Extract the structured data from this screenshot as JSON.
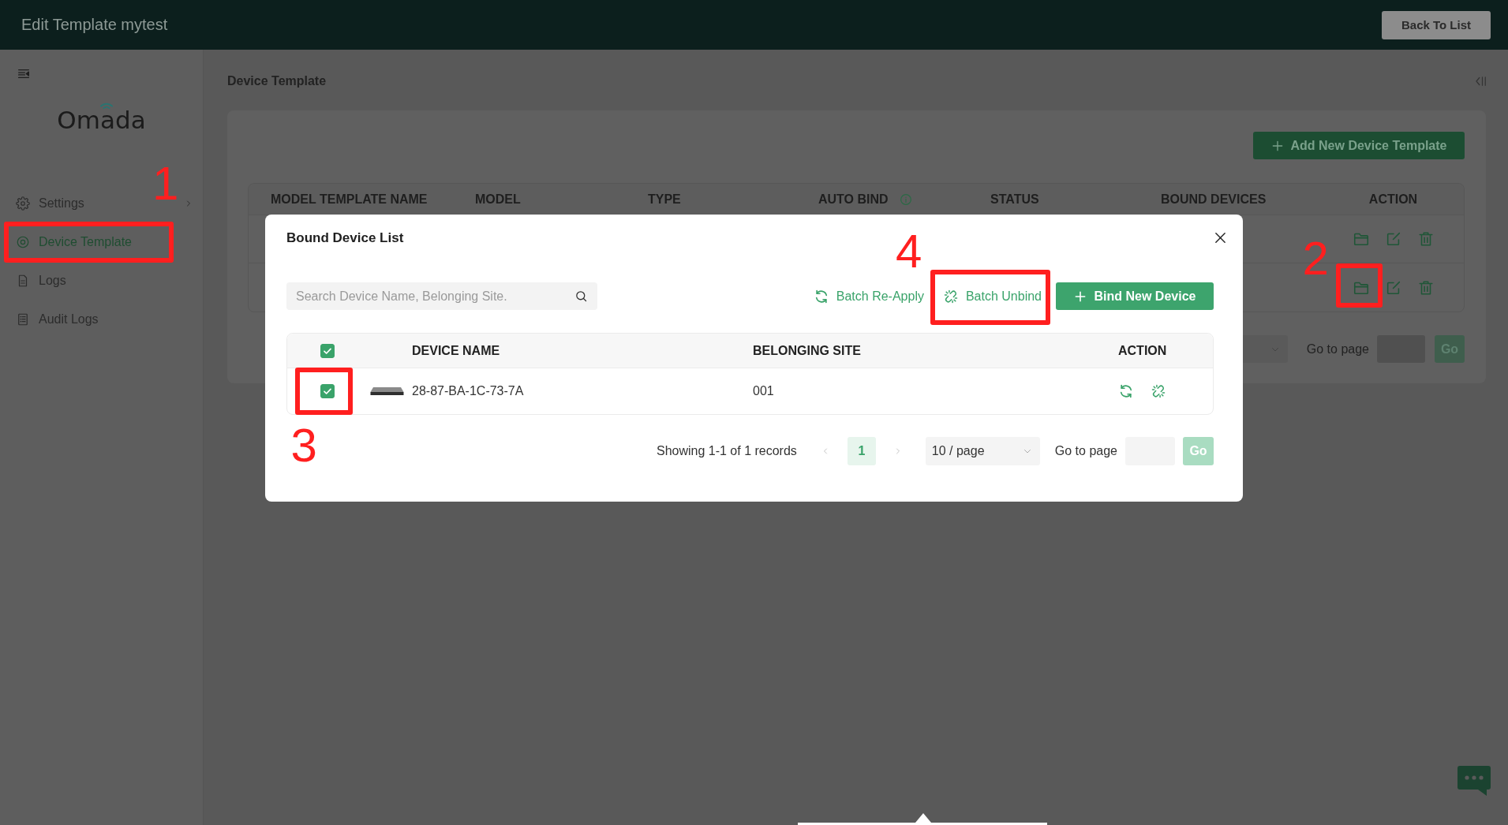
{
  "header": {
    "title": "Edit Template mytest",
    "back_button": "Back To List"
  },
  "sidebar": {
    "logo": "Omada",
    "items": [
      {
        "label": "Settings",
        "kind": "group",
        "selected": false
      },
      {
        "label": "Device Template",
        "kind": "page",
        "selected": true,
        "callout": "1"
      },
      {
        "label": "Logs",
        "kind": "page",
        "selected": false
      },
      {
        "label": "Audit Logs",
        "kind": "page",
        "selected": false
      }
    ]
  },
  "breadcrumb": "Device Template",
  "templates": {
    "add_button": "Add New Device Template",
    "columns": [
      {
        "label": "MODEL TEMPLATE NAME",
        "kind": "plain"
      },
      {
        "label": "MODEL",
        "kind": "plain"
      },
      {
        "label": "TYPE",
        "kind": "plain"
      },
      {
        "label": "AUTO BIND",
        "kind": "hint"
      },
      {
        "label": "STATUS",
        "kind": "plain"
      },
      {
        "label": "BOUND DEVICES",
        "kind": "plain"
      },
      {
        "label": "ACTION",
        "kind": "plain"
      }
    ],
    "rows": [
      {},
      {
        "callout": "2"
      }
    ],
    "pagination": {
      "go_to_page_label": "Go to page",
      "go_button": "Go"
    }
  },
  "modal": {
    "title": "Bound Device List",
    "search": {
      "placeholder": "Search Device Name, Belonging Site."
    },
    "actions": [
      {
        "label": "Batch Re-Apply",
        "kind": "reapply"
      },
      {
        "label": "Batch Unbind",
        "kind": "unbind",
        "callout": "4"
      }
    ],
    "bind_button": "Bind New Device",
    "table": {
      "columns": [
        {
          "label": "DEVICE NAME"
        },
        {
          "label": "BELONGING SITE"
        },
        {
          "label": "ACTION"
        }
      ],
      "all_checked": true,
      "rows": [
        {
          "checked": true,
          "device_name": "28-87-BA-1C-73-7A",
          "site": "001",
          "callout": "3"
        }
      ]
    },
    "pagination": {
      "summary": "Showing 1-1 of 1 records",
      "pages": [
        {
          "label": "1",
          "selected": true
        }
      ],
      "page_size": "10 / page",
      "go_to_page_label": "Go to page",
      "go_button": "Go"
    }
  }
}
